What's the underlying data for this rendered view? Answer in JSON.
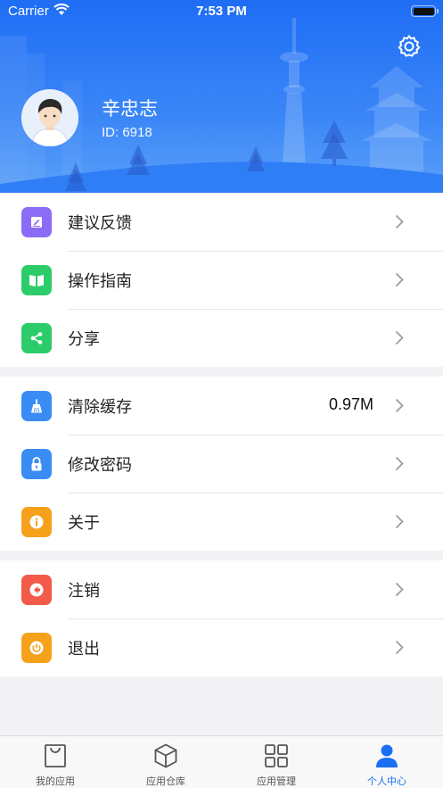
{
  "status_bar": {
    "carrier": "Carrier",
    "time": "7:53 PM"
  },
  "profile": {
    "name": "辛忠志",
    "id": "ID: 6918"
  },
  "menu_groups": [
    [
      {
        "label": "建议反馈",
        "icon": "edit-icon",
        "color": "#8b6cf6"
      },
      {
        "label": "操作指南",
        "icon": "book-icon",
        "color": "#2ccc6a"
      },
      {
        "label": "分享",
        "icon": "share-icon",
        "color": "#2ccc6a"
      }
    ],
    [
      {
        "label": "清除缓存",
        "value": "0.97M",
        "icon": "broom-icon",
        "color": "#3a8cf5"
      },
      {
        "label": "修改密码",
        "icon": "lock-icon",
        "color": "#3a8cf5"
      },
      {
        "label": "关于",
        "icon": "info-icon",
        "color": "#f5a11c"
      }
    ],
    [
      {
        "label": "注销",
        "icon": "logout-icon",
        "color": "#f25a4a"
      },
      {
        "label": "退出",
        "icon": "power-icon",
        "color": "#f5a11c"
      }
    ]
  ],
  "tabs": [
    {
      "label": "我的应用",
      "icon": "bag-icon",
      "active": false
    },
    {
      "label": "应用仓库",
      "icon": "box-icon",
      "active": false
    },
    {
      "label": "应用管理",
      "icon": "grid-icon",
      "active": false
    },
    {
      "label": "个人中心",
      "icon": "person-icon",
      "active": true
    }
  ],
  "colors": {
    "accent": "#1a6ff5",
    "header_top": "#1f6df5",
    "header_bottom": "#5aa0f8"
  }
}
